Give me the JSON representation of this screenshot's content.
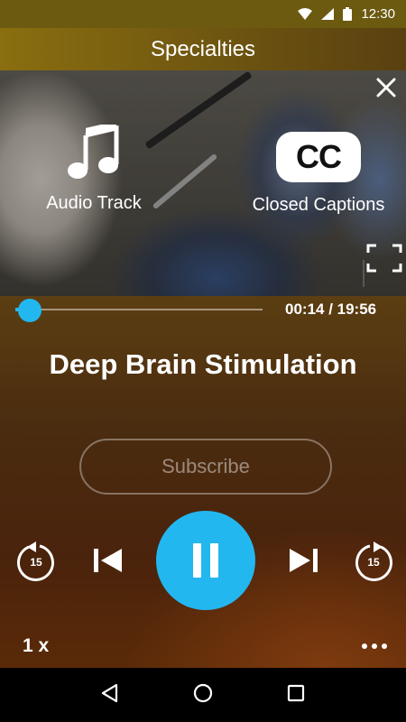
{
  "status_bar": {
    "time": "12:30"
  },
  "header": {
    "title": "Specialties"
  },
  "video_overlay": {
    "audio_track_label": "Audio Track",
    "closed_captions_label": "Closed Captions",
    "cc_badge": "CC"
  },
  "player": {
    "time_display": "00:14 / 19:56",
    "progress": 0.012,
    "title": "Deep Brain Stimulation",
    "subscribe_label": "Subscribe",
    "rewind_seconds": "15",
    "forward_seconds": "15",
    "speed": "1 x"
  },
  "colors": {
    "accent": "#23b7f0",
    "header": "#7a6210"
  },
  "icons": {
    "status": [
      "wifi-icon",
      "signal-icon",
      "battery-icon"
    ],
    "nav": [
      "back-icon",
      "home-icon",
      "recents-icon"
    ]
  }
}
